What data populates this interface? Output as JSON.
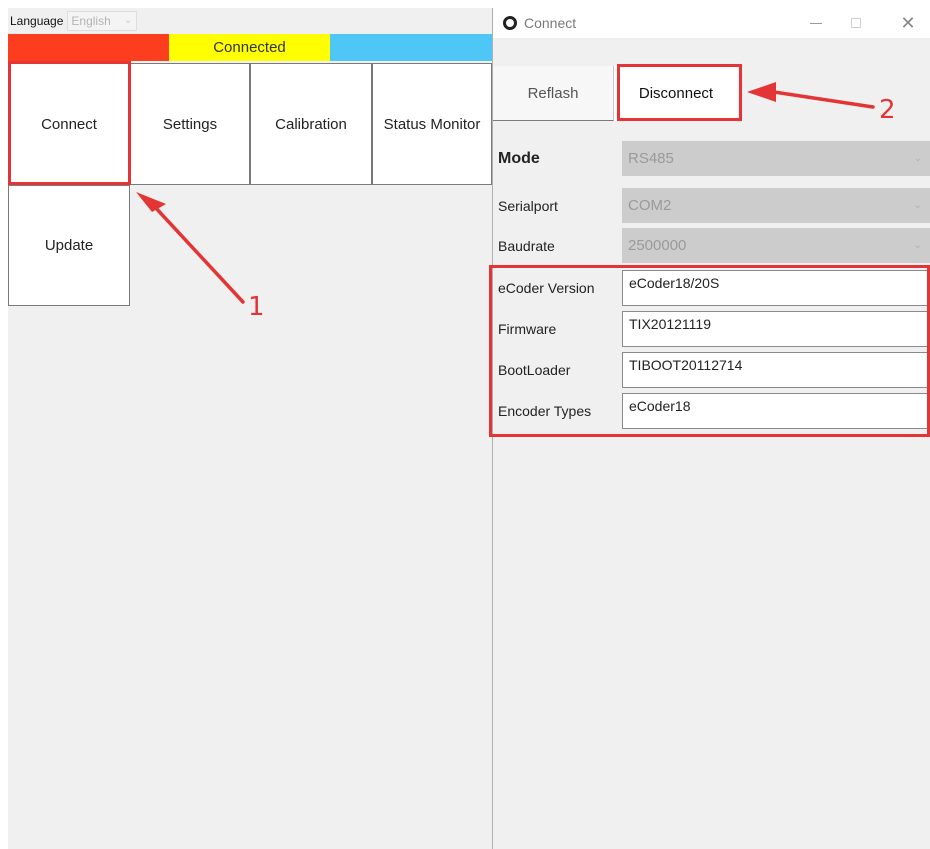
{
  "app": {
    "language_label": "Language",
    "language_value": "English",
    "status_text": "Connected",
    "status_colors": {
      "left": "#fd3e1e",
      "middle": "#ffff00",
      "right": "#4fc7f6"
    },
    "tiles": {
      "connect": "Connect",
      "settings": "Settings",
      "calibration": "Calibration",
      "status_monitor": "Status Monitor",
      "update": "Update"
    }
  },
  "dialog": {
    "title": "Connect",
    "tabs": {
      "reflash": "Reflash",
      "disconnect": "Disconnect"
    },
    "fields": {
      "mode": {
        "label": "Mode",
        "value": "RS485"
      },
      "serialport": {
        "label": "Serialport",
        "value": "COM2"
      },
      "baudrate": {
        "label": "Baudrate",
        "value": "2500000"
      },
      "ecoder_version": {
        "label": "eCoder Version",
        "value": "eCoder18/20S"
      },
      "firmware": {
        "label": "Firmware",
        "value": "TIX20121119"
      },
      "bootloader": {
        "label": "BootLoader",
        "value": "TIBOOT20112714"
      },
      "encoder_types": {
        "label": "Encoder Types",
        "value": "eCoder18"
      }
    }
  },
  "annotations": {
    "step1": "1",
    "step2": "2",
    "color": "#e33535"
  }
}
